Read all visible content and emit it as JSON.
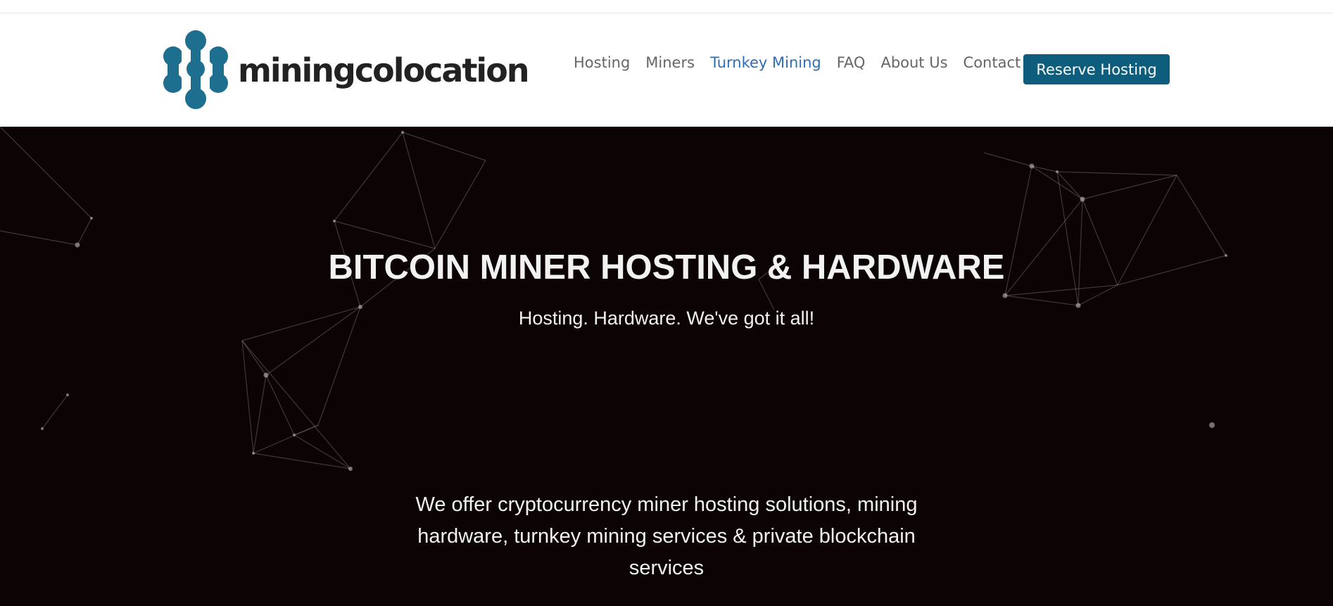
{
  "brand": {
    "name": "miningcolocation",
    "logo_color": "#1d6e8f"
  },
  "nav": {
    "items": [
      {
        "label": "Hosting",
        "active": false
      },
      {
        "label": "Miners",
        "active": false
      },
      {
        "label": "Turnkey Mining",
        "active": true
      },
      {
        "label": "FAQ",
        "active": false
      },
      {
        "label": "About Us",
        "active": false
      },
      {
        "label": "Contact",
        "active": false
      }
    ],
    "cta_label": "Reserve Hosting",
    "cta_color": "#0f5d7d",
    "active_color": "#2e6db8"
  },
  "hero": {
    "title": "BITCOIN MINER HOSTING & HARDWARE",
    "subtitle": "Hosting. Hardware. We've got it all!",
    "description": "We offer cryptocurrency miner hosting solutions, mining hardware, turnkey mining services & private blockchain services",
    "background_color": "#0c0304"
  }
}
